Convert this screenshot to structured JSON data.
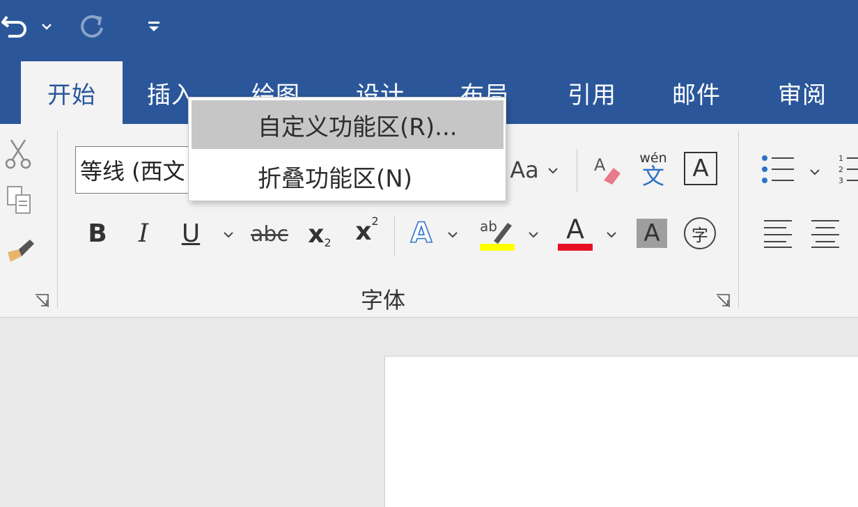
{
  "quick_access": {
    "undo_icon": "undo-icon",
    "undo_dropdown_icon": "chevron-down-icon",
    "redo_icon": "redo-icon",
    "customize_icon": "customize-quick-access-icon"
  },
  "tabs": [
    {
      "label": "开始",
      "active": true
    },
    {
      "label": "插入"
    },
    {
      "label": "绘图"
    },
    {
      "label": "设计"
    },
    {
      "label": "布局"
    },
    {
      "label": "引用"
    },
    {
      "label": "邮件"
    },
    {
      "label": "审阅"
    }
  ],
  "clipboard": {
    "cut_icon": "scissors-icon",
    "copy_icon": "copy-icon",
    "format_painter_icon": "format-painter-icon",
    "launcher_icon": "dialog-launcher-icon"
  },
  "font_group": {
    "label": "字体",
    "font_name": "等线 (西文",
    "change_case_label": "Aa",
    "clear_format_icon": "eraser-icon",
    "phonetic_top": "wén",
    "phonetic_bottom": "文",
    "char_border_label": "A",
    "bold": "B",
    "italic": "I",
    "underline": "U",
    "strike": "abc",
    "subscript_base": "x",
    "subscript_mark": "2",
    "superscript_base": "x",
    "superscript_mark": "2",
    "text_effect": "A",
    "highlight_text": "ab",
    "highlight_color": "#ffff00",
    "font_color_label": "A",
    "font_color": "#e81123",
    "char_shading": "A",
    "enclose_char": "字"
  },
  "context_menu": {
    "items": [
      {
        "label": "自定义功能区(R)...",
        "highlighted": true
      },
      {
        "label": "折叠功能区(N)"
      }
    ]
  },
  "colors": {
    "title_bar": "#2b579a",
    "ribbon_bg": "#f3f3f3",
    "menu_highlight": "#c6c6c6"
  }
}
